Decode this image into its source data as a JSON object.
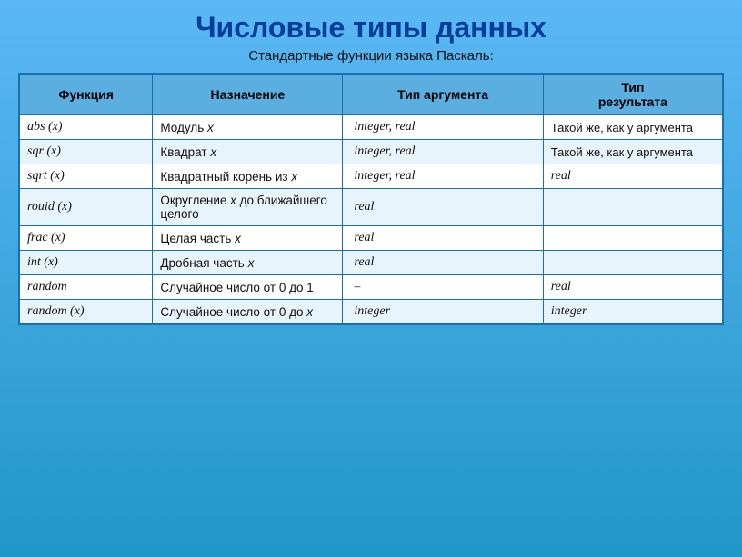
{
  "page": {
    "title": "Числовые типы данных",
    "subtitle": "Стандартные  функции языка Паскаль:"
  },
  "table": {
    "headers": [
      "Функция",
      "Назначение",
      "Тип аргумента",
      "Тип результата"
    ],
    "rows": [
      {
        "func": "abs (x)",
        "desc_before": "Модуль ",
        "desc_var": "x",
        "arg_type": "integer, real",
        "res_type": "Такой же, как у аргумента",
        "res_italic": false
      },
      {
        "func": "sqr (x)",
        "desc_before": "Квадрат ",
        "desc_var": "x",
        "arg_type": "integer, real",
        "res_type": "Такой же, как у аргумента",
        "res_italic": false
      },
      {
        "func": "sqrt (x)",
        "desc_before": "Квадратный корень из ",
        "desc_var": "x",
        "arg_type": "integer, real",
        "res_type": "real",
        "res_italic": true
      },
      {
        "func": "rouid (x)",
        "desc_before": "Округление ",
        "desc_var": "x",
        "desc_after": " до ближайшего целого",
        "arg_type": "real",
        "res_type": "",
        "res_italic": true
      },
      {
        "func": "frac (x)",
        "desc_before": "Целая часть ",
        "desc_var": "x",
        "arg_type": "real",
        "res_type": "",
        "res_italic": true
      },
      {
        "func": "int (x)",
        "desc_before": "Дробная часть ",
        "desc_var": "x",
        "arg_type": "real",
        "res_type": "",
        "res_italic": true
      },
      {
        "func": "random",
        "desc_before": "Случайное число от 0 до 1",
        "desc_var": "",
        "arg_type": "–",
        "res_type": "real",
        "res_italic": true
      },
      {
        "func": "random (x)",
        "desc_before": "Случайное число от 0 до ",
        "desc_var": "x",
        "arg_type": "integer",
        "res_type": "integer",
        "res_italic": true
      }
    ]
  }
}
